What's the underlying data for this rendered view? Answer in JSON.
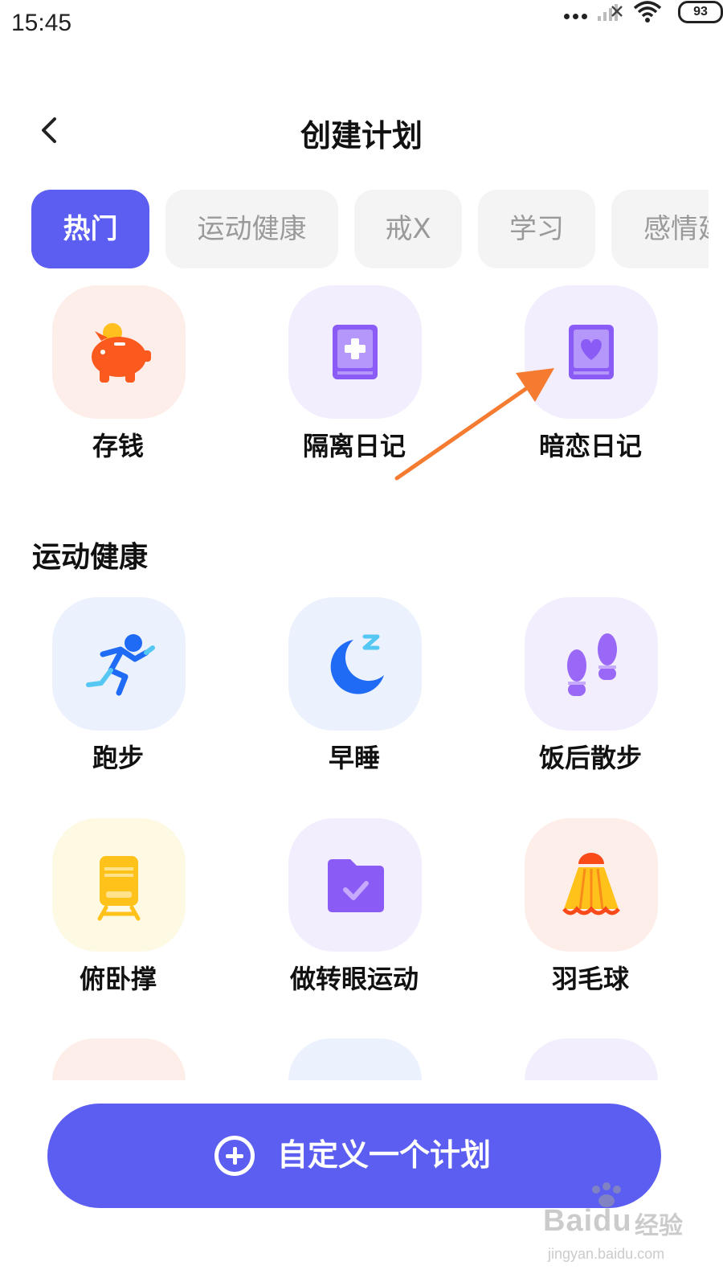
{
  "status_bar": {
    "time": "15:45",
    "battery": "93"
  },
  "header": {
    "title": "创建计划",
    "back_icon": "chevron-left-icon"
  },
  "tabs": [
    {
      "label": "热门",
      "active": true
    },
    {
      "label": "运动健康",
      "active": false
    },
    {
      "label": "戒X",
      "active": false
    },
    {
      "label": "学习",
      "active": false
    },
    {
      "label": "感情建",
      "active": false
    }
  ],
  "popular": [
    {
      "label": "存钱",
      "icon": "piggy-bank-icon"
    },
    {
      "label": "隔离日记",
      "icon": "medical-book-icon"
    },
    {
      "label": "暗恋日记",
      "icon": "heart-book-icon"
    }
  ],
  "sports_section": {
    "title": "运动健康",
    "items": [
      {
        "label": "跑步",
        "icon": "runner-icon"
      },
      {
        "label": "早睡",
        "icon": "moon-sleep-icon"
      },
      {
        "label": "饭后散步",
        "icon": "footprints-icon"
      },
      {
        "label": "俯卧撑",
        "icon": "train-icon"
      },
      {
        "label": "做转眼运动",
        "icon": "folder-check-icon"
      },
      {
        "label": "羽毛球",
        "icon": "shuttlecock-icon"
      }
    ]
  },
  "custom_button": {
    "label": "自定义一个计划",
    "icon": "plus-circle-icon"
  },
  "watermark": {
    "brand": "Baidu",
    "cn": "经验",
    "url": "jingyan.baidu.com"
  },
  "colors": {
    "accent": "#5b5ef0",
    "arrow": "#f47b30"
  }
}
